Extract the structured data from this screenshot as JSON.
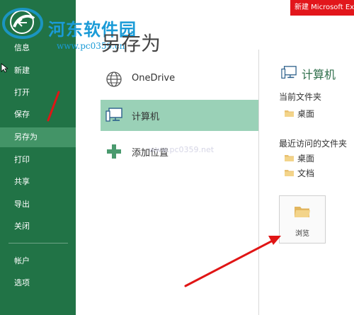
{
  "titlebar": {
    "text": "新建 Microsoft Exc"
  },
  "watermark": {
    "name": "河东软件园",
    "url": "www.pc0359.cn",
    "faint": "www.pc0359.net"
  },
  "sidebar": {
    "items": [
      {
        "label": "信息"
      },
      {
        "label": "新建"
      },
      {
        "label": "打开"
      },
      {
        "label": "保存"
      },
      {
        "label": "另存为"
      },
      {
        "label": "打印"
      },
      {
        "label": "共享"
      },
      {
        "label": "导出"
      },
      {
        "label": "关闭"
      },
      {
        "label": "帐户"
      },
      {
        "label": "选项"
      }
    ]
  },
  "page": {
    "title": "另存为"
  },
  "locations": [
    {
      "label": "OneDrive",
      "icon": "globe-icon"
    },
    {
      "label": "计算机",
      "icon": "computer-icon"
    },
    {
      "label": "添加位置",
      "icon": "plus-icon"
    }
  ],
  "right": {
    "title": "计算机",
    "current_folder_label": "当前文件夹",
    "current_folders": [
      {
        "label": "桌面"
      }
    ],
    "recent_label": "最近访问的文件夹",
    "recent_folders": [
      {
        "label": "桌面"
      },
      {
        "label": "文档"
      }
    ],
    "browse_label": "浏览"
  },
  "colors": {
    "sidebar": "#217346",
    "sidebar_active": "#439467",
    "selected": "#9ad1b7",
    "title_red": "#e2161b",
    "accent": "#2f6f4b",
    "arrow": "#e01515"
  }
}
